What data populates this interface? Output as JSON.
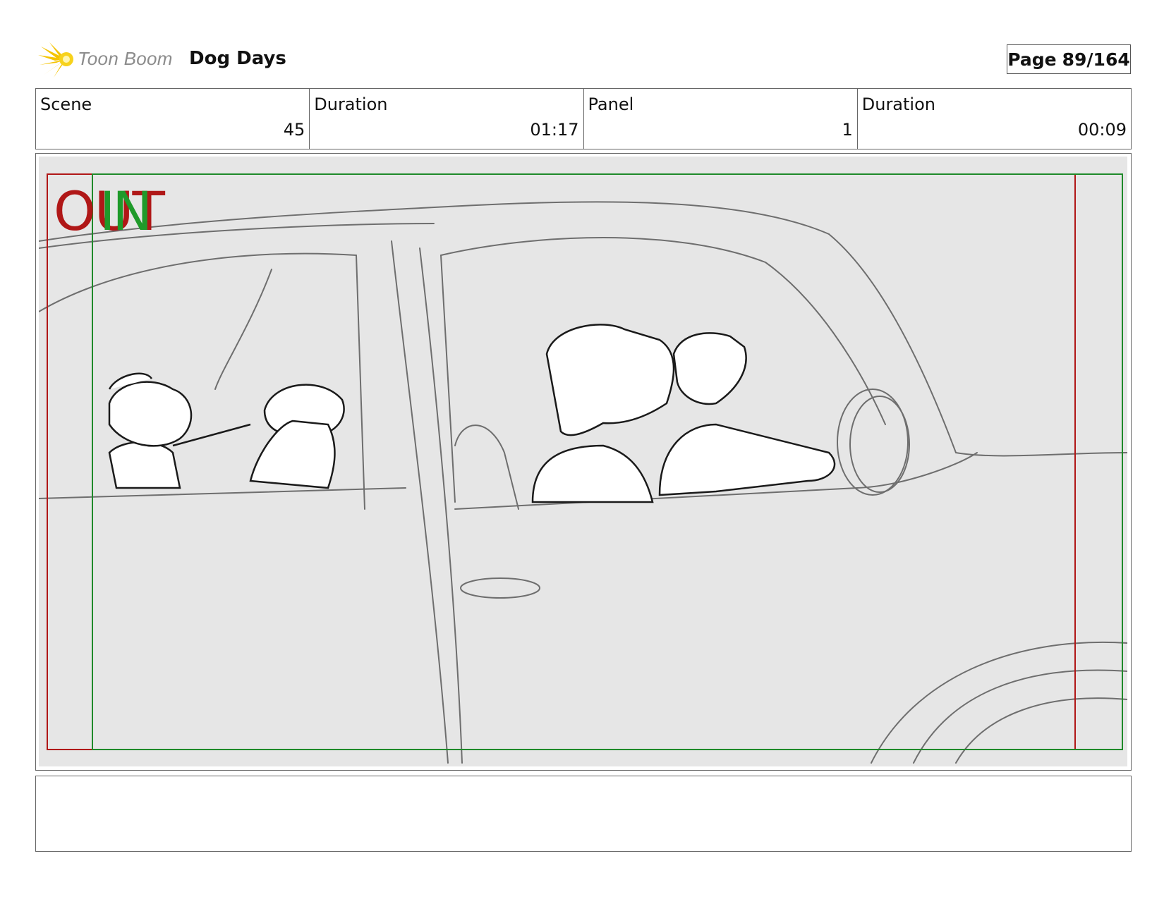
{
  "header": {
    "logo_text": "Toon Boom",
    "project_title": "Dog Days",
    "page_label": "Page",
    "page_number": "89/164"
  },
  "info": {
    "scene_label": "Scene",
    "scene_value": "45",
    "scene_duration_label": "Duration",
    "scene_duration_value": "01:17",
    "panel_label": "Panel",
    "panel_value": "1",
    "panel_duration_label": "Duration",
    "panel_duration_value": "00:09"
  },
  "panel": {
    "out_label": "OUT",
    "in_label": "IN",
    "out_frame_color": "#b01717",
    "in_frame_color": "#1f8a2a"
  },
  "notes": {
    "text": ""
  }
}
